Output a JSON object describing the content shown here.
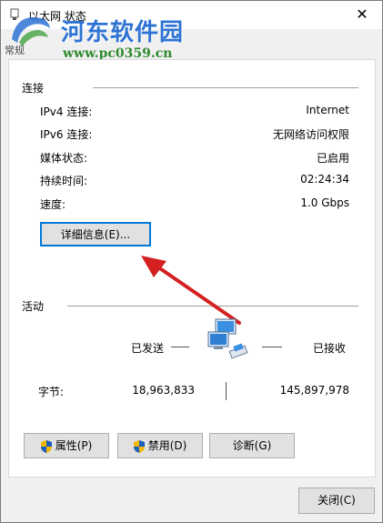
{
  "window": {
    "title": "以太网 状态",
    "close_glyph": "✕"
  },
  "watermark": {
    "site_name": "河东软件园",
    "url": "www.pc0359.cn",
    "tab_fragment": "常规"
  },
  "connection": {
    "group_label": "连接",
    "rows": [
      {
        "label": "IPv4 连接:",
        "value": "Internet"
      },
      {
        "label": "IPv6 连接:",
        "value": "无网络访问权限"
      },
      {
        "label": "媒体状态:",
        "value": "已启用"
      },
      {
        "label": "持续时间:",
        "value": "02:24:34"
      },
      {
        "label": "速度:",
        "value": "1.0 Gbps"
      }
    ],
    "details_button": "详细信息(E)..."
  },
  "activity": {
    "group_label": "活动",
    "sent_label": "已发送",
    "received_label": "已接收",
    "bytes_label": "字节:",
    "bytes_sent": "18,963,833",
    "bytes_received": "145,897,978"
  },
  "actions": {
    "properties": "属性(P)",
    "disable": "禁用(D)",
    "diagnose": "诊断(G)",
    "close": "关闭(C)"
  },
  "colors": {
    "focus_blue": "#0078d7",
    "arrow_red": "#d42020",
    "watermark_blue": "#2e73d4",
    "watermark_green": "#2f8a2f"
  }
}
